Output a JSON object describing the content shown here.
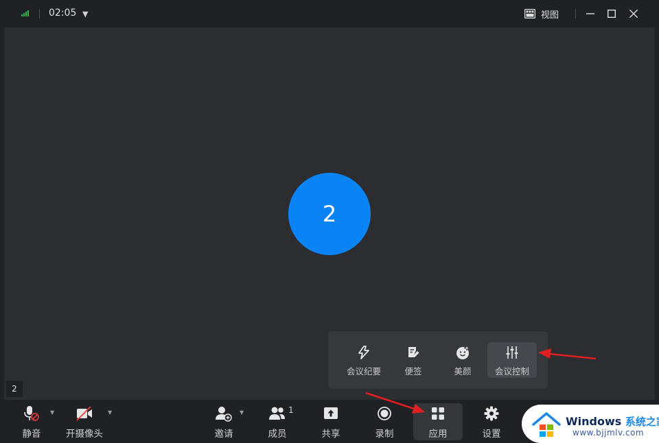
{
  "titlebar": {
    "timer": "02:05",
    "view_label": "视图"
  },
  "stage": {
    "avatar_text": "2",
    "name_tag": "2",
    "avatar_color": "#0a84f5"
  },
  "apps_panel": {
    "items": [
      {
        "label": "会议纪要",
        "icon": "lightning-note-icon"
      },
      {
        "label": "便签",
        "icon": "note-pen-icon"
      },
      {
        "label": "美颜",
        "icon": "beauty-face-icon"
      },
      {
        "label": "会议控制",
        "icon": "sliders-icon",
        "selected": true
      }
    ]
  },
  "toolbar": {
    "mute": "静音",
    "camera": "开摄像头",
    "invite": "邀请",
    "members": "成员",
    "members_count": "1",
    "share": "共享",
    "record": "录制",
    "apps": "应用",
    "settings": "设置"
  },
  "watermark": {
    "title": "Windows",
    "title_cn": "系统之家",
    "url": "www.bjjmlv.com"
  },
  "colors": {
    "annotation_arrow": "#e02020",
    "signal": "#2fb457"
  }
}
